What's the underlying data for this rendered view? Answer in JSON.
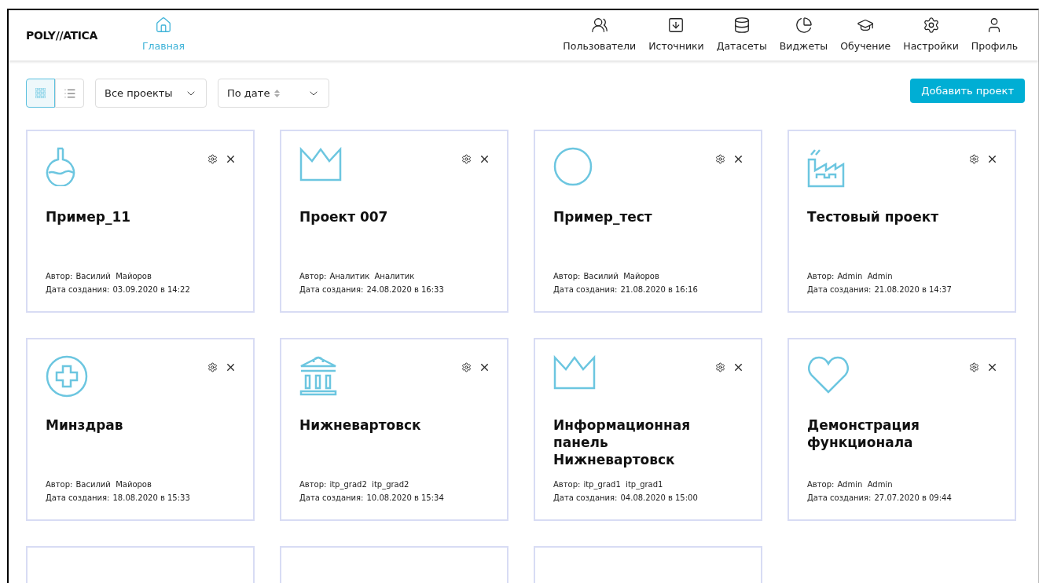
{
  "logo": {
    "text": "POLY//ATICA"
  },
  "nav": [
    {
      "label": "Главная",
      "kind": "home",
      "selected": true
    },
    {
      "label": "Пользователи",
      "kind": "users",
      "selected": false
    },
    {
      "label": "Источники",
      "kind": "sources",
      "selected": false
    },
    {
      "label": "Датасеты",
      "kind": "database",
      "selected": false
    },
    {
      "label": "Виджеты",
      "kind": "widgets",
      "selected": false
    },
    {
      "label": "Обучение",
      "kind": "education",
      "selected": false
    },
    {
      "label": "Настройки",
      "kind": "settings",
      "selected": false
    },
    {
      "label": "Профиль",
      "kind": "profile",
      "selected": false
    }
  ],
  "toolbar": {
    "views": [
      {
        "kind": "grid",
        "selected": true
      },
      {
        "kind": "list",
        "selected": false
      }
    ],
    "filters": [
      {
        "kind": "plain",
        "value": "Все проекты"
      },
      {
        "kind": "sort",
        "value": "По дате"
      }
    ],
    "add_button": "Добавить проект"
  },
  "projects": [
    {
      "kind": "flask",
      "title": "Пример_11",
      "author_label": "Автор:",
      "author": "Василий  Майоров",
      "date_label": "Дата создания:",
      "date": "03.09.2020 в 14:22"
    },
    {
      "kind": "crown",
      "title": "Проект 007",
      "author_label": "Автор:",
      "author": "Аналитик  Аналитик",
      "date_label": "Дата создания:",
      "date": "24.08.2020 в 16:33"
    },
    {
      "kind": "circle",
      "title": "Пример_тест",
      "author_label": "Автор:",
      "author": "Василий  Майоров",
      "date_label": "Дата создания:",
      "date": "21.08.2020 в 16:16"
    },
    {
      "kind": "factory",
      "title": "Тестовый проект",
      "author_label": "Автор:",
      "author": "Admin  Admin",
      "date_label": "Дата создания:",
      "date": "21.08.2020 в 14:37"
    },
    {
      "kind": "cross",
      "title": "Минздрав",
      "author_label": "Автор:",
      "author": "Василий  Майоров",
      "date_label": "Дата создания:",
      "date": "18.08.2020 в 15:33"
    },
    {
      "kind": "building",
      "title": "Нижневартовск",
      "author_label": "Автор:",
      "author": "itp_grad2  itp_grad2",
      "date_label": "Дата создания:",
      "date": "10.08.2020 в 15:34"
    },
    {
      "kind": "crown",
      "title": "Информационная панель Нижневартовск",
      "author_label": "Автор:",
      "author": "itp_grad1  itp_grad1",
      "date_label": "Дата создания:",
      "date": "04.08.2020 в 15:00"
    },
    {
      "kind": "heart",
      "title": "Демонстрация функционала",
      "author_label": "Автор:",
      "author": "Admin  Admin",
      "date_label": "Дата создания:",
      "date": "27.07.2020 в 09:44"
    }
  ],
  "cut_off_cards": [
    {
      "kind": "card"
    },
    {
      "kind": "card"
    },
    {
      "kind": "card"
    }
  ]
}
